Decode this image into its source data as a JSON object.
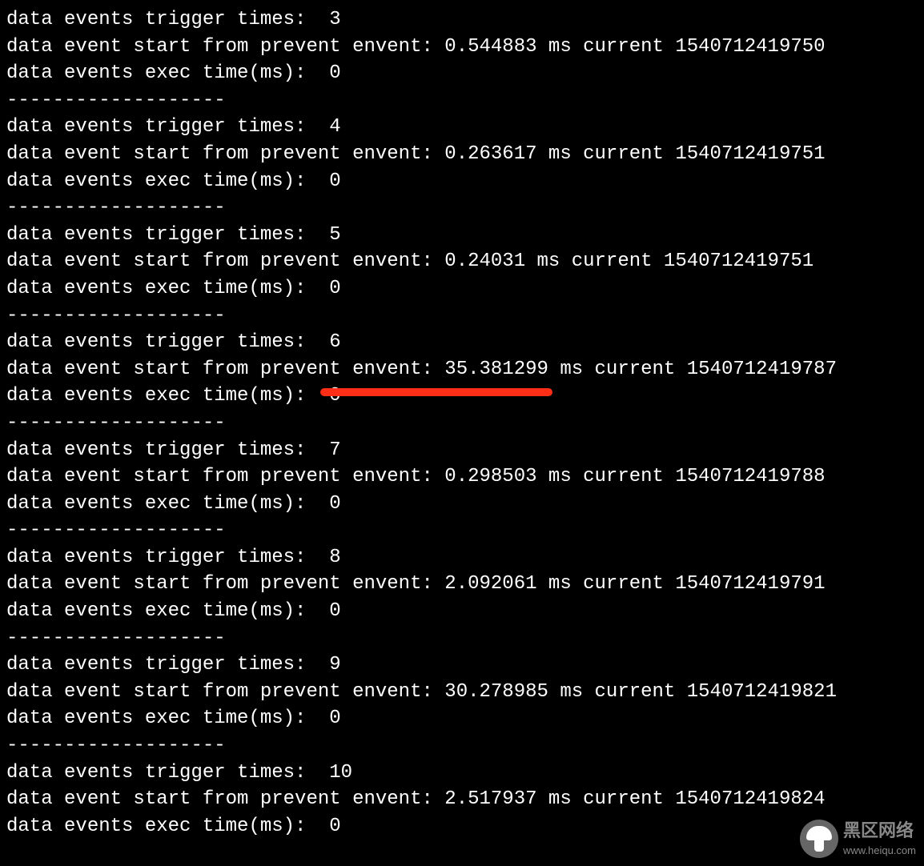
{
  "separator": "-------------------",
  "blocks": [
    {
      "trigger": "data events trigger times:  3",
      "start": "data event start from prevent envent: 0.544883 ms current 1540712419750",
      "exec": "data events exec time(ms):  0",
      "highlighted": false
    },
    {
      "trigger": "data events trigger times:  4",
      "start": "data event start from prevent envent: 0.263617 ms current 1540712419751",
      "exec": "data events exec time(ms):  0",
      "highlighted": false
    },
    {
      "trigger": "data events trigger times:  5",
      "start": "data event start from prevent envent: 0.24031 ms current 1540712419751",
      "exec": "data events exec time(ms):  0",
      "highlighted": false
    },
    {
      "trigger": "data events trigger times:  6",
      "start": "data event start from prevent envent: 35.381299 ms current 1540712419787",
      "exec": "data events exec time(ms):  0",
      "highlighted": true
    },
    {
      "trigger": "data events trigger times:  7",
      "start": "data event start from prevent envent: 0.298503 ms current 1540712419788",
      "exec": "data events exec time(ms):  0",
      "highlighted": false
    },
    {
      "trigger": "data events trigger times:  8",
      "start": "data event start from prevent envent: 2.092061 ms current 1540712419791",
      "exec": "data events exec time(ms):  0",
      "highlighted": false
    },
    {
      "trigger": "data events trigger times:  9",
      "start": "data event start from prevent envent: 30.278985 ms current 1540712419821",
      "exec": "data events exec time(ms):  0",
      "highlighted": false
    },
    {
      "trigger": "data events trigger times:  10",
      "start": "data event start from prevent envent: 2.517937 ms current 1540712419824",
      "exec": "data events exec time(ms):  0",
      "highlighted": false
    }
  ],
  "watermark": {
    "title": "黑区网络",
    "url": "www.heiqu.com"
  }
}
